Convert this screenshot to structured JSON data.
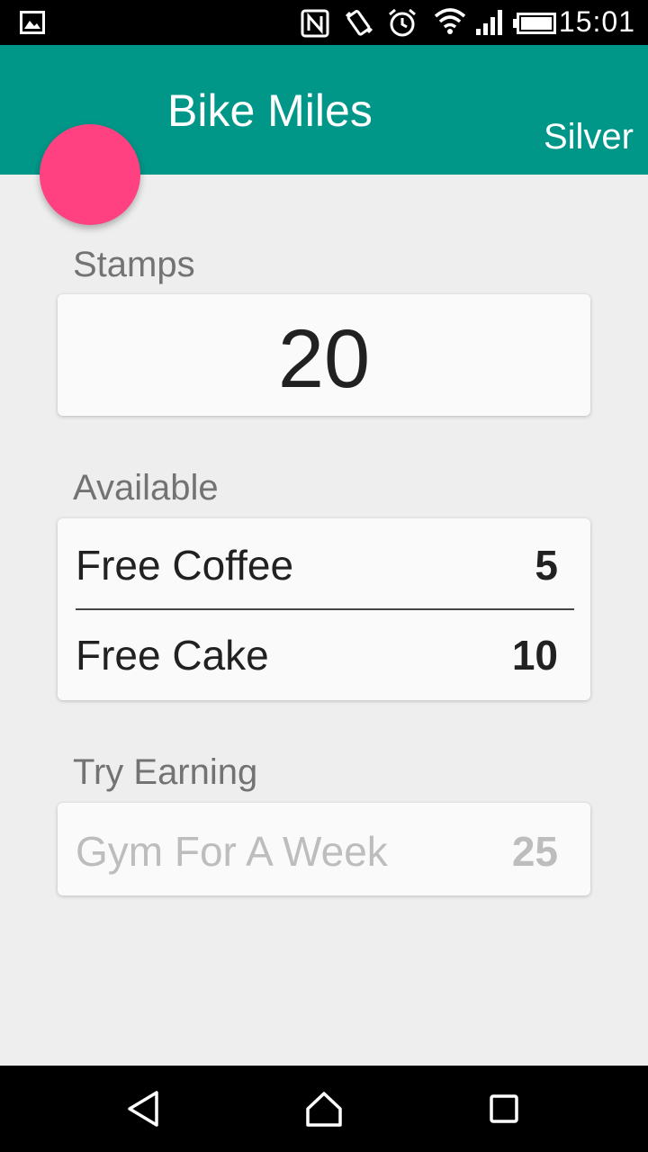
{
  "status_bar": {
    "time": "15:01",
    "icons": [
      "image-notification-icon",
      "nfc-icon",
      "vibrate-icon",
      "alarm-icon",
      "wifi-icon",
      "signal-icon",
      "battery-icon"
    ]
  },
  "app_bar": {
    "title": "Bike Miles",
    "tier": "Silver"
  },
  "colors": {
    "primary": "#009688",
    "accent": "#ff4081",
    "background": "#eeeeee"
  },
  "stamps": {
    "label": "Stamps",
    "value": "20"
  },
  "available": {
    "label": "Available",
    "items": [
      {
        "name": "Free Coffee",
        "cost": "5"
      },
      {
        "name": "Free Cake",
        "cost": "10"
      }
    ]
  },
  "try_earning": {
    "label": "Try Earning",
    "items": [
      {
        "name": "Gym For A Week",
        "cost": "25"
      }
    ]
  },
  "nav_bar": {
    "icons": [
      "back-icon",
      "home-icon",
      "recents-icon"
    ]
  }
}
